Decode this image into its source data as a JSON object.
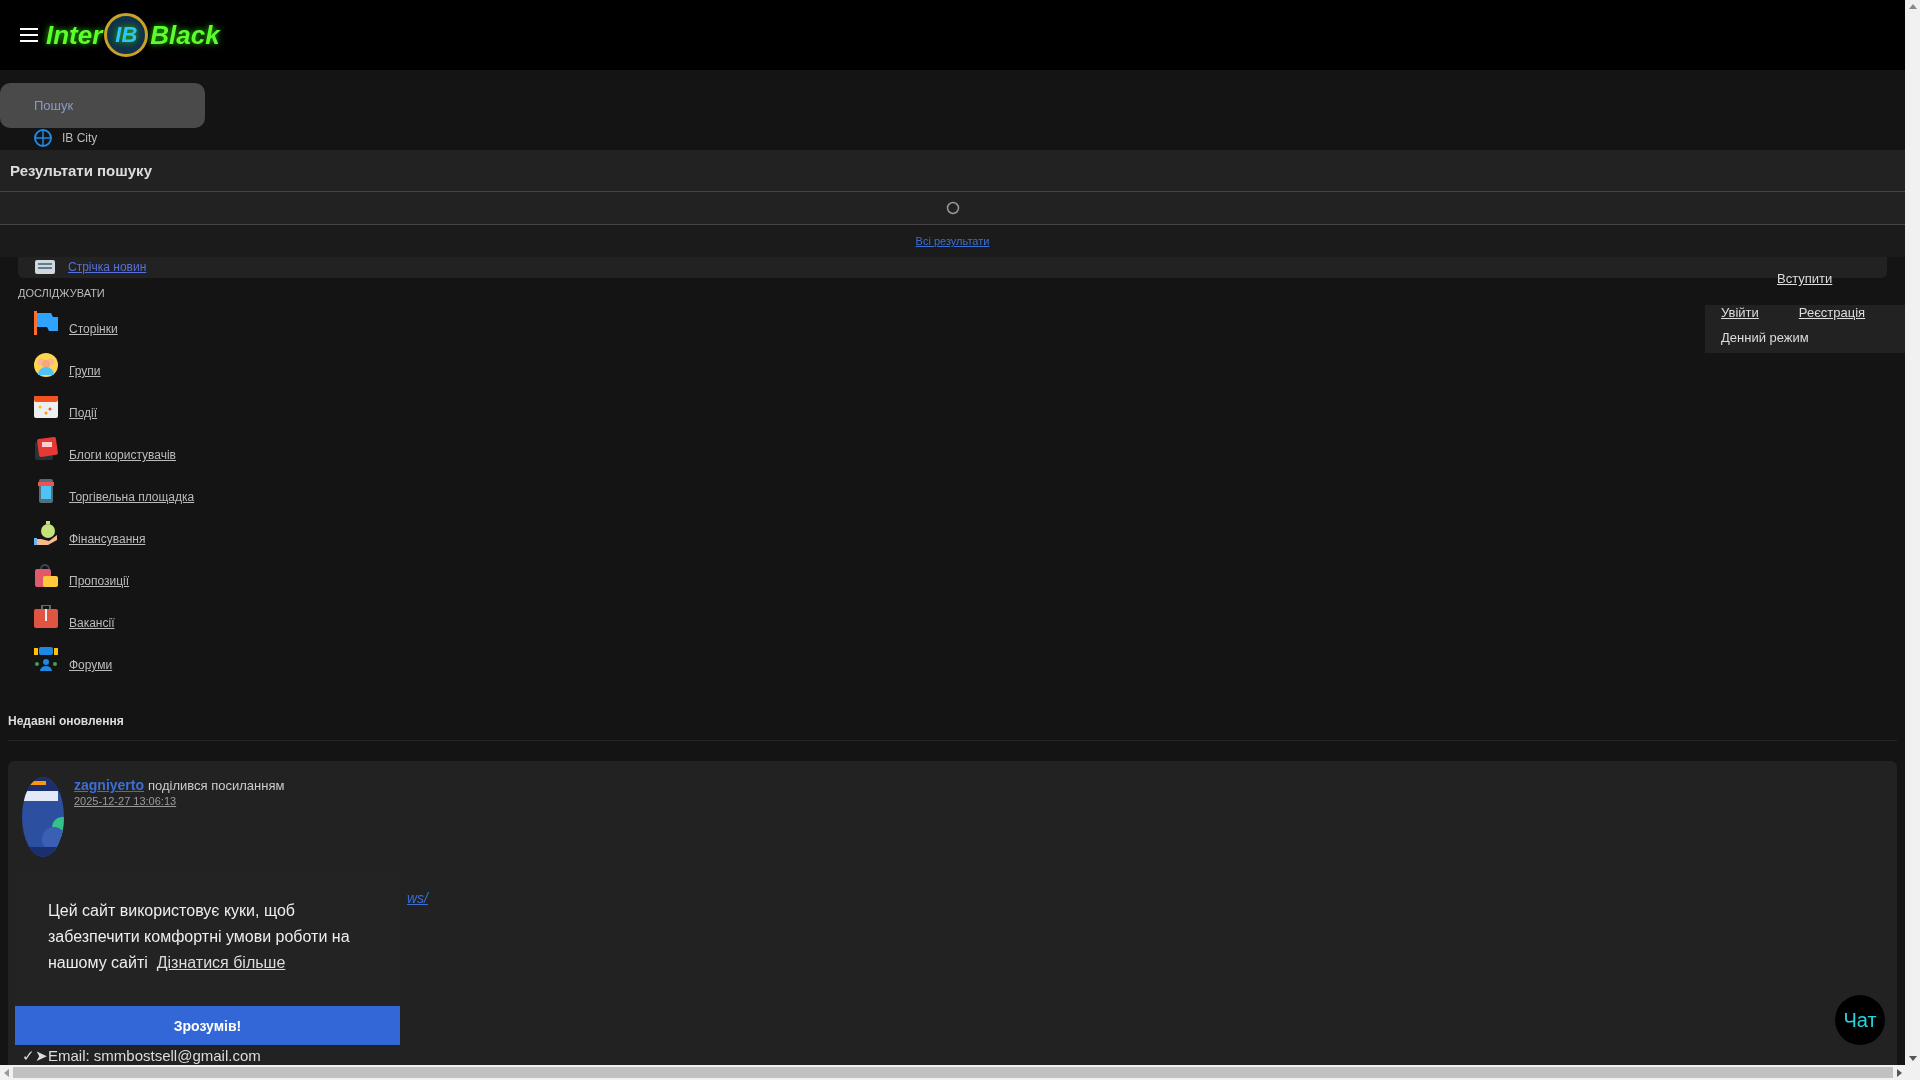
{
  "header": {
    "logo": {
      "left": "Inter",
      "badge": "IB",
      "right": "Black"
    }
  },
  "search": {
    "placeholder": "Пошук"
  },
  "sidebar": {
    "top_items": [
      {
        "label": "IB City"
      },
      {
        "label": "Стрічка новин"
      }
    ],
    "section_title": "ДОСЛІДЖУВАТИ",
    "items": [
      {
        "label": "Сторінки"
      },
      {
        "label": "Групи"
      },
      {
        "label": "Події"
      },
      {
        "label": "Блоги користувачів"
      },
      {
        "label": "Торгівельна площадка"
      },
      {
        "label": "Фінансування"
      },
      {
        "label": "Пропозиції"
      },
      {
        "label": "Вакансії"
      },
      {
        "label": "Форуми"
      }
    ]
  },
  "search_results": {
    "title": "Результати пошуку",
    "loading": true,
    "all_results_link": "Всі результати"
  },
  "user_menu": {
    "join_link": "Вступити",
    "items": [
      {
        "label": "Увійти",
        "kind": "link"
      },
      {
        "label": "Реєстрація",
        "kind": "link"
      },
      {
        "label": "Денний режим",
        "kind": "toggle"
      }
    ]
  },
  "recent": {
    "title": "Недавні оновлення",
    "post": {
      "author": "zagniyerto",
      "action": "поділився посиланням",
      "time": "2025-12-27 13:06:13",
      "link_fragment": "ws/",
      "text": "✓➤Email: smmbostsell@gmail.com"
    }
  },
  "cookie": {
    "message": "Цей сайт використовує куки, щоб забезпечити комфортні умови роботи на нашому сайті",
    "link": "Дізнатися більше",
    "button": "Зрозумів!"
  },
  "chat": {
    "label": "Чат"
  }
}
